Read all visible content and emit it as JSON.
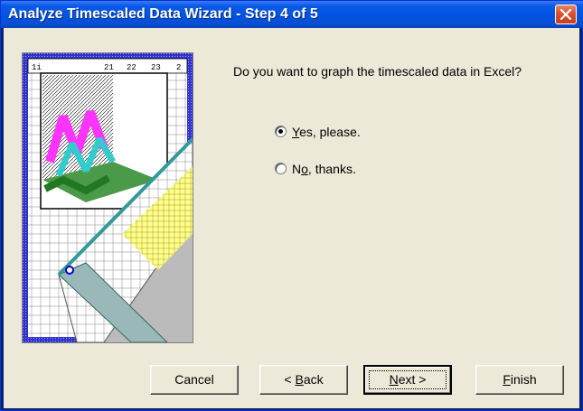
{
  "window": {
    "title": "Analyze Timescaled Data Wizard - Step 4 of 5"
  },
  "content": {
    "question": "Do you want to graph the timescaled data in Excel?",
    "options": [
      {
        "label_pre": "",
        "mnemonic": "Y",
        "label_post": "es, please.",
        "selected": true
      },
      {
        "label_pre": "N",
        "mnemonic": "o",
        "label_post": ", thanks.",
        "selected": false
      }
    ]
  },
  "buttons": {
    "cancel": {
      "label_pre": "Cancel",
      "mnemonic": "",
      "label_post": ""
    },
    "back": {
      "label_pre": "< ",
      "mnemonic": "B",
      "label_post": "ack"
    },
    "next": {
      "label_pre": "",
      "mnemonic": "N",
      "label_post": "ext >"
    },
    "finish": {
      "label_pre": "",
      "mnemonic": "F",
      "label_post": "inish"
    }
  },
  "illustration": {
    "column_headers": [
      "1i",
      "21",
      "22",
      "23",
      "2"
    ],
    "colors": {
      "pink": "#ff33ff",
      "cyan": "#33cccc",
      "green": "#338833",
      "yellow": "#ffff88",
      "teal": "#339999",
      "frame": "#3333cc"
    }
  }
}
